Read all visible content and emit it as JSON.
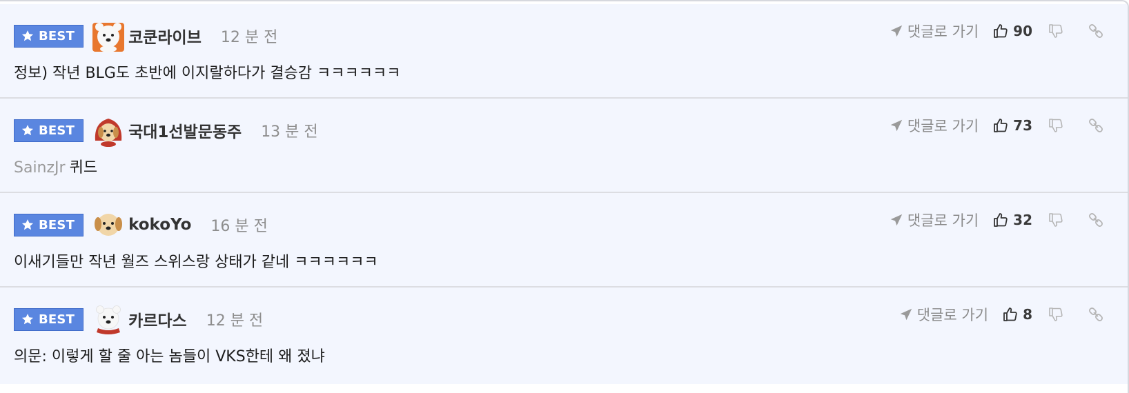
{
  "badge_label": "BEST",
  "goto_reply_label": "댓글로 가기",
  "comments": [
    {
      "username": "코쿤라이브",
      "time": "12 분 전",
      "likes": "90",
      "reply_to": "",
      "text": "정보) 작년 BLG도 초반에 이지랄하다가 결승감 ㅋㅋㅋㅋㅋㅋ",
      "avatar": "polar-bear-avatar"
    },
    {
      "username": "국대1선발문동주",
      "time": "13 분 전",
      "likes": "73",
      "reply_to": "SainzJr",
      "text": "퀴드",
      "avatar": "puppy-hood-avatar"
    },
    {
      "username": "kokoYo",
      "time": "16 분 전",
      "likes": "32",
      "reply_to": "",
      "text": "이새기들만 작년 월즈 스위스랑 상태가 같네 ㅋㅋㅋㅋㅋㅋ",
      "avatar": "puppy-avatar"
    },
    {
      "username": "카르다스",
      "time": "12 분 전",
      "likes": "8",
      "reply_to": "",
      "text": "의문: 이렇게 할 줄 아는 놈들이 VKS한테 왜 졌냐",
      "avatar": "polar-bear-scarf-avatar"
    }
  ],
  "colors": {
    "row_background": "#f3f6fe",
    "badge": "#5a86e0",
    "divider": "#dcdde2"
  }
}
